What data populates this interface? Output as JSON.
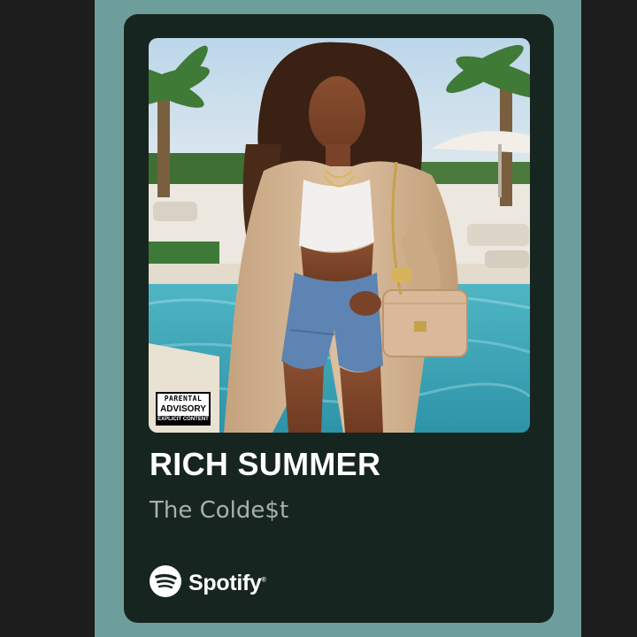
{
  "card": {
    "title": "RICH SUMMER",
    "artist": "The Colde$t",
    "brand": "Spotify",
    "brand_mark": "®"
  },
  "artwork": {
    "description_icon": "album-cover-image",
    "advisory": {
      "line1": "PARENTAL",
      "line2": "ADVISORY",
      "line3": "EXPLICIT CONTENT"
    }
  },
  "colors": {
    "background_teal": "#6e9e9b",
    "card_bg": "#16251f",
    "title": "#ffffff",
    "artist": "#a8b0ad"
  }
}
